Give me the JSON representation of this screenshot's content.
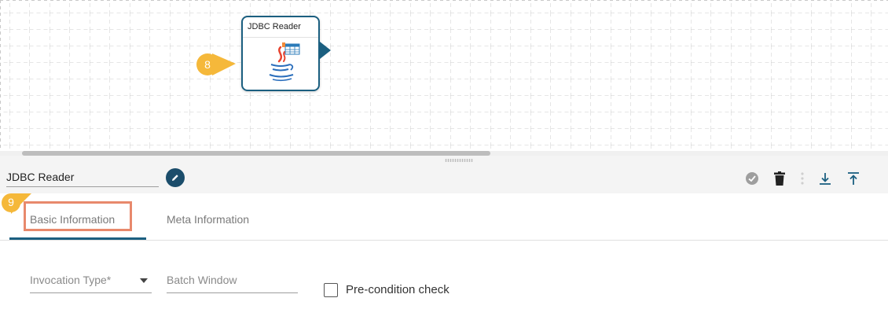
{
  "canvas": {
    "node": {
      "title": "JDBC Reader",
      "icon": "java-icon"
    },
    "badge_8": "8"
  },
  "panel": {
    "name_value": "JDBC Reader",
    "badge_9": "9",
    "toolbar": {
      "validate_icon": "check-circle-icon",
      "delete_icon": "trash-icon",
      "more_icon": "vertical-dots-icon",
      "download_icon": "download-icon",
      "upload_icon": "upload-icon"
    },
    "tabs": [
      {
        "label": "Basic Information",
        "active": true
      },
      {
        "label": "Meta Information",
        "active": false
      }
    ],
    "form": {
      "invocation_type_placeholder": "Invocation Type*",
      "batch_window_placeholder": "Batch Window",
      "precondition_label": "Pre-condition check",
      "precondition_checked": false
    }
  },
  "colors": {
    "accent": "#1b5f80",
    "badge": "#f5b83a",
    "highlight": "#e8896c"
  }
}
